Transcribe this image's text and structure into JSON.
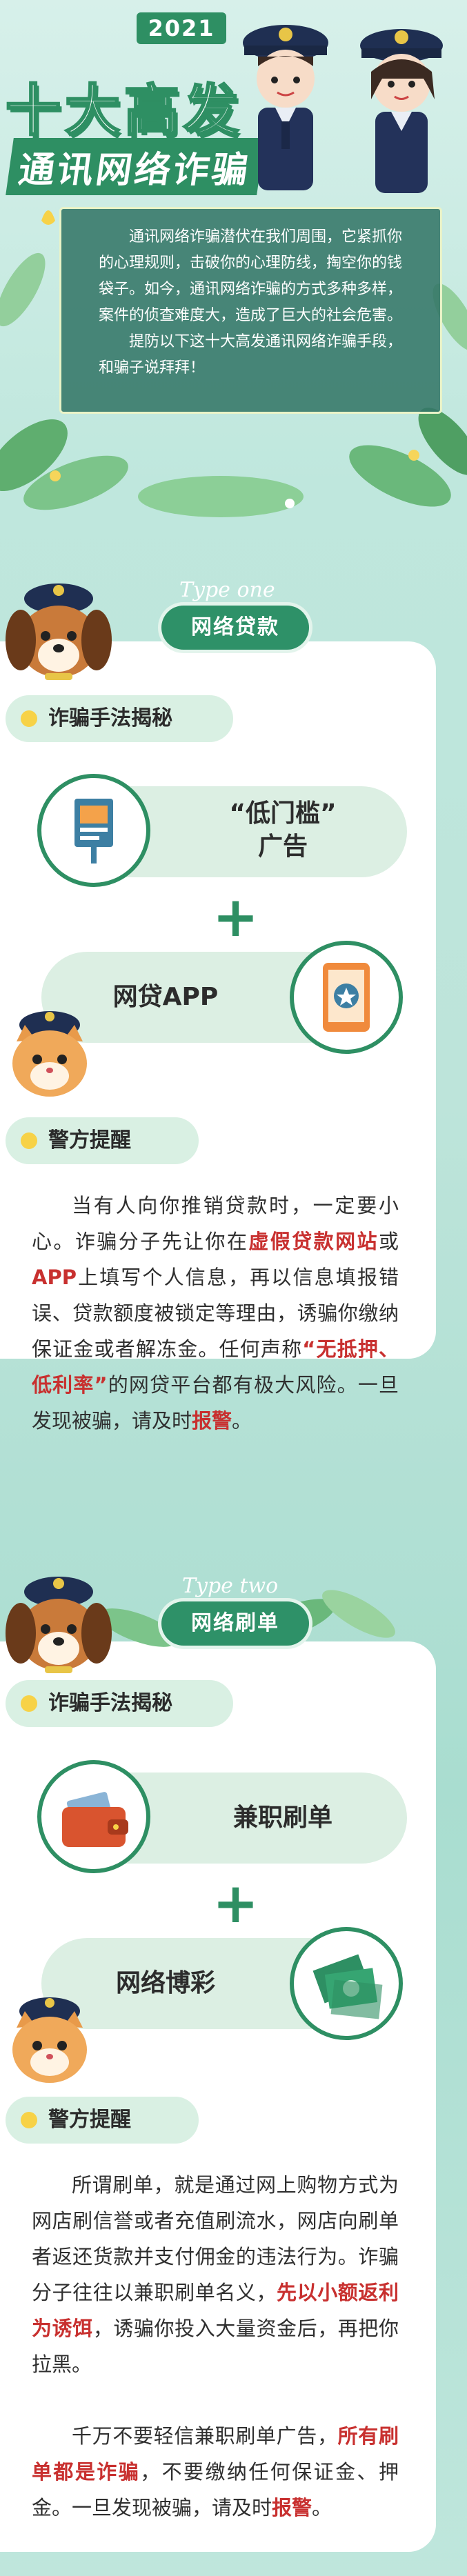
{
  "header": {
    "year": "2021",
    "title": "十大高发",
    "subtitle": "通讯网络诈骗",
    "intro_p1": "通讯网络诈骗潜伏在我们周围，它紧抓你的心理规则，击破你的心理防线，掏空你的钱袋子。如今，通讯网络诈骗的方式多种多样，案件的侦查难度大，造成了巨大的社会危害。",
    "intro_p2": "提防以下这十大高发通讯网络诈骗手段，和骗子说拜拜！"
  },
  "sections": [
    {
      "type_label": "Type one",
      "name": "网络贷款",
      "reveal_tag": "诈骗手法揭秘",
      "tactic1": "“低门槛”",
      "tactic1_line2": "广告",
      "plus": "+",
      "tactic2": "网贷APP",
      "warning_tag": "警方提醒",
      "text_a": "当有人向你推销贷款时，一定要小心。诈骗分子先让你在",
      "text_red1": "虚假贷款网站",
      "text_b": "或",
      "text_red2": "APP",
      "text_c": "上填写个人信息，再以信息填报错误、贷款额度被锁定等理由，诱骗你缴纳保证金或者解冻金。任何声称",
      "text_red3": "“无抵押、低利率”",
      "text_d": "的网贷平台都有极大风险。一旦发现被骗，请及时",
      "text_red4": "报警",
      "text_e": "。"
    },
    {
      "type_label": "Type two",
      "name": "网络刷单",
      "reveal_tag": "诈骗手法揭秘",
      "tactic1": "兼职刷单",
      "plus": "+",
      "tactic2": "网络博彩",
      "warning_tag": "警方提醒",
      "p1": "所谓刷单，就是通过网上购物方式为网店刷信誉或者充值刷流水，网店向刷单者返还货款并支付佣金的违法行为。诈骗分子往往以兼职刷单名义，",
      "p1_red": "先以小额返利为诱饵",
      "p1_tail": "，诱骗你投入大量资金后，再把你拉黑。",
      "p2_a": "千万不要轻信兼职刷单广告，",
      "p2_red": "所有刷单都是诈骗",
      "p2_b": "，不要缴纳任何保证金、押金。一旦发现被骗，请及时",
      "p2_red2": "报警",
      "p2_c": "。"
    }
  ],
  "colors": {
    "primary_green": "#2e8f63",
    "pill_green": "#2e9168",
    "light_green": "#dcefe3",
    "warning_red": "#c8302f",
    "dot_yellow": "#f7d247"
  },
  "icons": [
    "police-officer-male-icon",
    "police-officer-female-icon",
    "police-dog-icon",
    "police-cat-icon",
    "billboard-icon",
    "tablet-app-icon",
    "wallet-icon",
    "money-stack-icon"
  ]
}
